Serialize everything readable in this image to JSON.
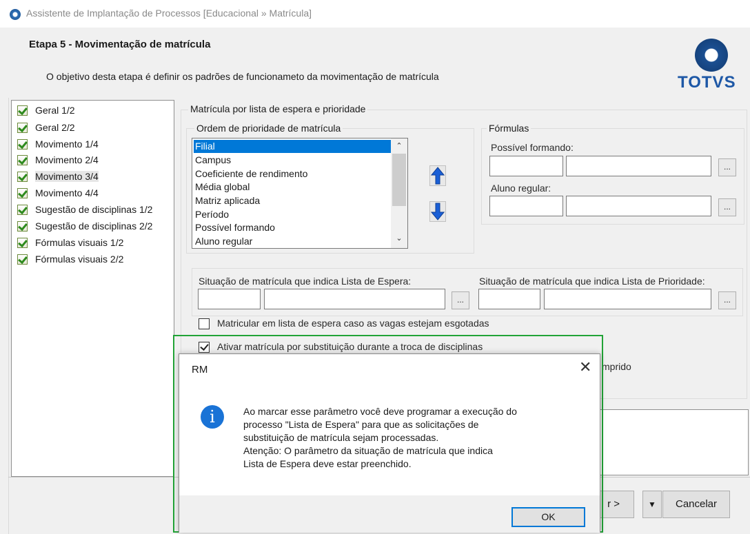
{
  "window": {
    "title": "Assistente de Implantação de Processos [Educacional » Matrícula]"
  },
  "header": {
    "step_title": "Etapa 5 - Movimentação de matrícula",
    "description": "O objetivo desta etapa é definir os padrões de funcionameto da movimentação de matrícula",
    "logo_text": "TOTVS"
  },
  "nav": {
    "items": [
      {
        "label": "Geral 1/2"
      },
      {
        "label": "Geral 2/2"
      },
      {
        "label": "Movimento 1/4"
      },
      {
        "label": "Movimento 2/4"
      },
      {
        "label": "Movimento 3/4"
      },
      {
        "label": "Movimento 4/4"
      },
      {
        "label": "Sugestão de disciplinas 1/2"
      },
      {
        "label": "Sugestão de disciplinas 2/2"
      },
      {
        "label": "Fórmulas visuais 1/2"
      },
      {
        "label": "Fórmulas visuais 2/2"
      }
    ],
    "selected": "Movimento 3/4"
  },
  "main": {
    "group_title": "Matrícula por lista de espera e prioridade",
    "priority": {
      "title": "Ordem de prioridade de matrícula",
      "items": [
        "Filial",
        "Campus",
        "Coeficiente de rendimento",
        "Média global",
        "Matriz aplicada",
        "Período",
        "Possível formando",
        "Aluno regular"
      ],
      "selected": "Filial"
    },
    "formulas": {
      "title": "Fórmulas",
      "possivel_formando_label": "Possível formando:",
      "aluno_regular_label": "Aluno regular:",
      "possivel_formando_code": "",
      "possivel_formando_desc": "",
      "aluno_regular_code": "",
      "aluno_regular_desc": ""
    },
    "situacao": {
      "espera_label": "Situação de matrícula que indica Lista de Espera:",
      "prioridade_label": "Situação de matrícula que indica Lista de Prioridade:",
      "espera_code": "",
      "espera_desc": "",
      "prioridade_code": "",
      "prioridade_desc": ""
    },
    "ellipsis": "...",
    "checkboxes": {
      "lista_espera_label": "Matricular em lista de espera caso as vagas estejam esgotadas",
      "lista_espera_checked": false,
      "substituicao_label": "Ativar matrícula por substituição durante a troca de disciplinas",
      "substituicao_checked": true,
      "partial_label": "mprido"
    }
  },
  "footer": {
    "next_label": "r >",
    "cancel_label": "Cancelar"
  },
  "dialog": {
    "title": "RM",
    "close_glyph": "✕",
    "info_glyph": "i",
    "message_lines": [
      "Ao marcar esse parâmetro você deve programar a execução do",
      "processo \"Lista de Espera\" para que as solicitações de",
      "substituição de matrícula sejam processadas.",
      "Atenção: O parâmetro da situação de matrícula que indica",
      "Lista de Espera deve estar preenchido."
    ],
    "ok_label": "OK"
  }
}
